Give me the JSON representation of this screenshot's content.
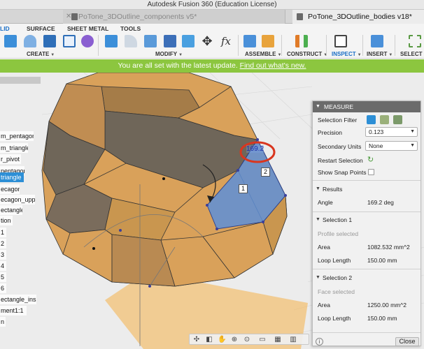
{
  "window": {
    "title": "Autodesk Fusion 360 (Education License)"
  },
  "document_tabs": [
    {
      "label": "PoTone_3DOutline_components v5*",
      "active": false
    },
    {
      "label": "PoTone_3DOutline_bodies v18*",
      "active": true
    }
  ],
  "ribbon": {
    "tabs": [
      "LID",
      "SURFACE",
      "SHEET METAL",
      "TOOLS"
    ],
    "active_tab": "LID",
    "groups": [
      "CREATE",
      "MODIFY",
      "ASSEMBLE",
      "CONSTRUCT",
      "INSPECT",
      "INSERT",
      "SELECT"
    ],
    "modify_function_glyph": "fx"
  },
  "banner": {
    "text": "You are all set with the latest update.",
    "link": "Find out what's new."
  },
  "browser": {
    "items": [
      {
        "label": "m_pentagon",
        "selected": false
      },
      {
        "label": "m_triangle",
        "selected": false
      },
      {
        "label": "r_pivot",
        "selected": false
      },
      {
        "label": "pentagon",
        "selected": false
      },
      {
        "label": "triangle",
        "selected": true
      },
      {
        "label": "ecagon",
        "selected": false
      },
      {
        "label": "ecagon_upper",
        "selected": false
      },
      {
        "label": "ectangle",
        "selected": false
      },
      {
        "label": "tion",
        "selected": false
      },
      {
        "label": "1",
        "selected": false
      },
      {
        "label": "2",
        "selected": false
      },
      {
        "label": "3",
        "selected": false
      },
      {
        "label": "4",
        "selected": false
      },
      {
        "label": "5",
        "selected": false
      },
      {
        "label": "6",
        "selected": false
      },
      {
        "label": "ectangle_inside",
        "selected": false
      },
      {
        "label": "ment1:1",
        "selected": false
      },
      {
        "label": "n",
        "selected": false
      }
    ]
  },
  "viewport": {
    "angle_label": "169.2",
    "callout_1": "1",
    "callout_2": "2",
    "colors": {
      "body": "#d9a15a",
      "body_dark": "#7a6a55",
      "selected_face": "#5d8fd8",
      "highlight_ring": "#d9361f"
    }
  },
  "measure": {
    "title": "MEASURE",
    "selection_filter_label": "Selection Filter",
    "precision_label": "Precision",
    "precision_value": "0.123",
    "secondary_units_label": "Secondary Units",
    "secondary_units_value": "None",
    "restart_selection_label": "Restart Selection",
    "show_snap_points_label": "Show Snap Points",
    "results_label": "Results",
    "angle_label": "Angle",
    "angle_value": "169.2 deg",
    "selection1": {
      "label": "Selection 1",
      "type": "Profile selected",
      "area_label": "Area",
      "area_value": "1082.532 mm^2",
      "loop_length_label": "Loop Length",
      "loop_length_value": "150.00 mm"
    },
    "selection2": {
      "label": "Selection 2",
      "type": "Face selected",
      "area_label": "Area",
      "area_value": "1250.00 mm^2",
      "loop_length_label": "Loop Length",
      "loop_length_value": "150.00 mm"
    },
    "close_label": "Close",
    "info_glyph": "i"
  }
}
